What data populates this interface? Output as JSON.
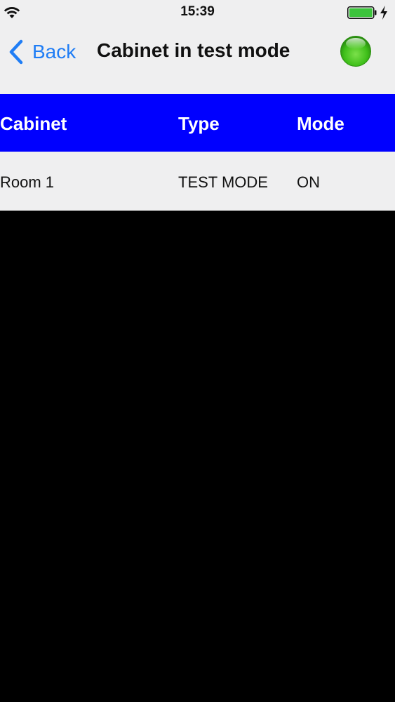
{
  "status_bar": {
    "time": "15:39",
    "icons": [
      "wifi-icon",
      "battery-icon",
      "charging-bolt-icon"
    ],
    "battery_color": "#3cc43c"
  },
  "nav": {
    "back_label": "Back",
    "title": "Cabinet in test mode",
    "status_indicator_color": "#3fbf1a",
    "accent_color": "#1f7df5"
  },
  "table": {
    "header_color": "#0000ff",
    "columns": [
      "Cabinet",
      "Type",
      "Mode"
    ],
    "rows": [
      [
        "Room 1",
        "TEST MODE",
        "ON"
      ]
    ]
  }
}
